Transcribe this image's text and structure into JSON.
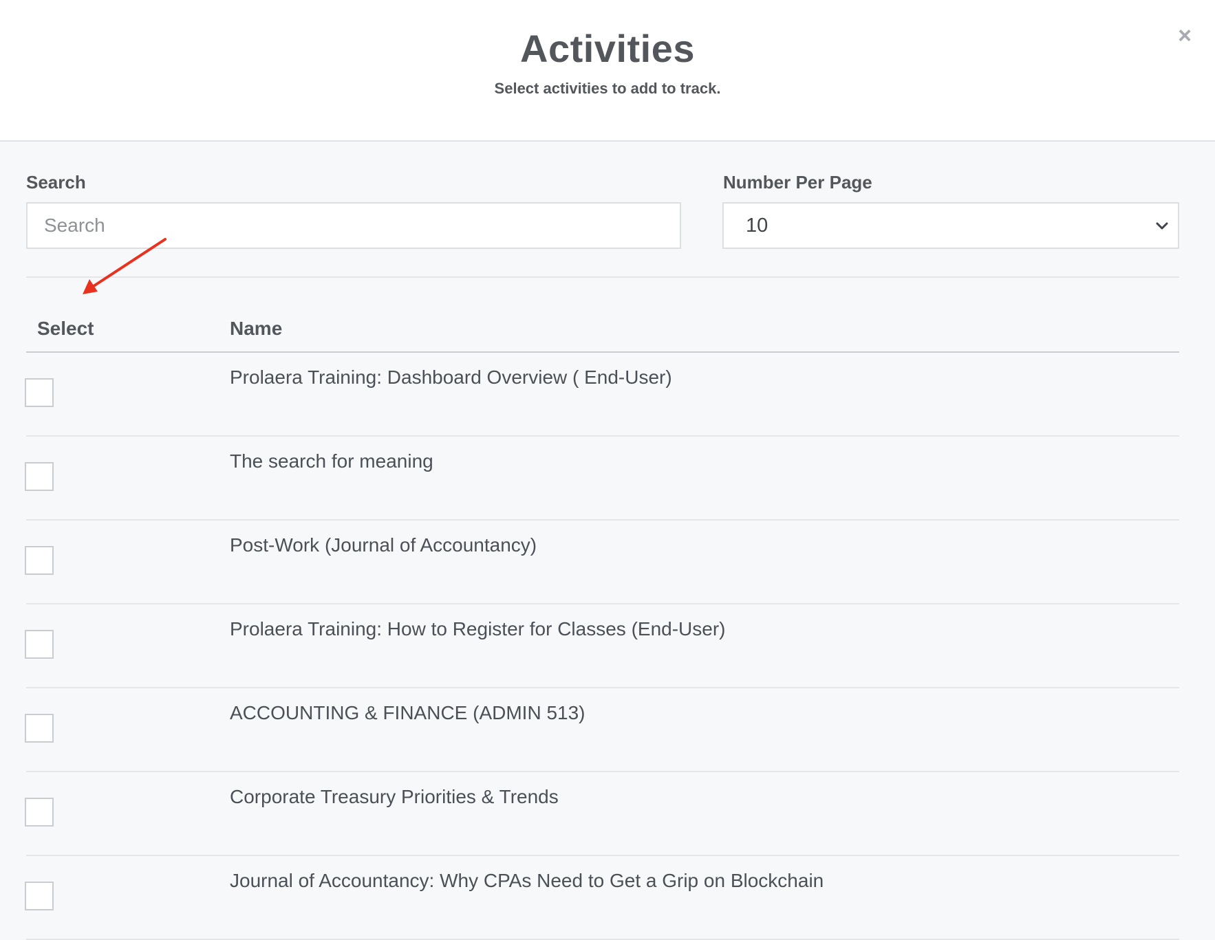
{
  "modal": {
    "title": "Activities",
    "subtitle": "Select activities to add to track.",
    "close_icon": "×"
  },
  "search": {
    "label": "Search",
    "placeholder": "Search",
    "value": ""
  },
  "per_page": {
    "label": "Number Per Page",
    "selected": "10"
  },
  "table": {
    "headers": {
      "select": "Select",
      "name": "Name"
    },
    "rows": [
      {
        "name": "Prolaera Training: Dashboard Overview ( End-User)",
        "checked": false
      },
      {
        "name": "The search for meaning",
        "checked": false
      },
      {
        "name": "Post-Work (Journal of Accountancy)",
        "checked": false
      },
      {
        "name": "Prolaera Training: How to Register for Classes (End-User)",
        "checked": false
      },
      {
        "name": "ACCOUNTING & FINANCE (ADMIN 513)",
        "checked": false
      },
      {
        "name": "Corporate Treasury Priorities & Trends",
        "checked": false
      },
      {
        "name": "Journal of Accountancy: Why CPAs Need to Get a Grip on Blockchain",
        "checked": false
      }
    ]
  },
  "colors": {
    "annotation_arrow": "#e8321f",
    "background": "#f7f8f9",
    "header_bg": "#ffffff"
  }
}
